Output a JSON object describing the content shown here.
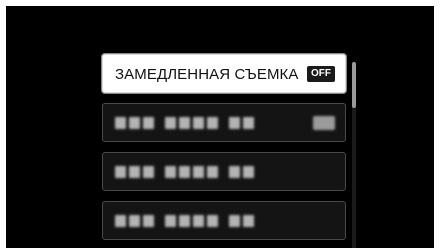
{
  "menu": {
    "items": [
      {
        "label": "ЗАМЕДЛЕННАЯ СЪЕМКА",
        "value": "OFF",
        "selected": true
      },
      {
        "label": "",
        "value": "",
        "selected": false
      },
      {
        "label": "",
        "value": "",
        "selected": false
      },
      {
        "label": "",
        "value": "",
        "selected": false
      }
    ]
  },
  "colors": {
    "background": "#000000",
    "selected_item": "#ffffff",
    "unselected_item": "#141414",
    "badge": "#1a1a1a"
  },
  "scrollbar": {
    "position": 0
  }
}
